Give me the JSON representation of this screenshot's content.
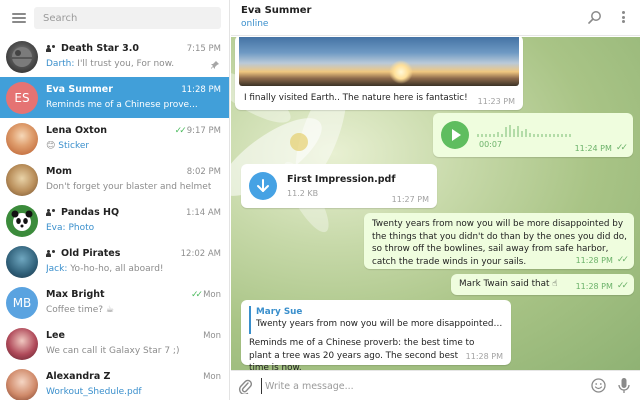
{
  "search": {
    "placeholder": "Search"
  },
  "chats": [
    {
      "name": "Death Star 3.0",
      "time": "7:15 PM",
      "sender": "Darth:",
      "message": "I'll trust you, For now.",
      "group": true,
      "pinned": true,
      "avatar_color": "#4a4a4a"
    },
    {
      "name": "Eva Summer",
      "time": "11:28 PM",
      "message": "Reminds me of a Chinese prove...",
      "initials": "ES",
      "avatar_color": "#e57373",
      "active": true
    },
    {
      "name": "Lena Oxton",
      "time": "9:17 PM",
      "icon_text": "😊",
      "message_link": "Sticker",
      "read": true,
      "avatar_color": "#f0a040"
    },
    {
      "name": "Mom",
      "time": "8:02 PM",
      "message": "Don't forget your blaster and helmet",
      "avatar_color": "#c9a66b"
    },
    {
      "name": "Pandas HQ",
      "time": "1:14 AM",
      "sender": "Eva:",
      "message_link": "Photo",
      "group": true,
      "avatar_color": "#2e7d32"
    },
    {
      "name": "Old Pirates",
      "time": "12:02 AM",
      "sender": "Jack:",
      "message": "Yo-ho-ho, all aboard!",
      "group": true,
      "avatar_color": "#3d6f8a"
    },
    {
      "name": "Max Bright",
      "time": "Mon",
      "message": "Coffee time? ☕",
      "initials": "MB",
      "avatar_color": "#5aa3e0",
      "read": true
    },
    {
      "name": "Lee",
      "time": "Mon",
      "message": "We can call it Galaxy Star 7 ;)",
      "avatar_color": "#b04a5a"
    },
    {
      "name": "Alexandra Z",
      "time": "Mon",
      "message_link": "Workout_Shedule.pdf",
      "avatar_color": "#d08a6a"
    }
  ],
  "header": {
    "name": "Eva Summer",
    "status": "online"
  },
  "messages": {
    "photo_caption": "I finally visited Earth.. The nature here is fantastic!",
    "photo_time": "11:23 PM",
    "voice_duration": "00:07",
    "voice_time": "11:24 PM",
    "file_name": "First Impression.pdf",
    "file_size": "11.2 KB",
    "file_time": "11:27 PM",
    "quote_text": "Twenty years from now you will be more disappointed by the things that you didn't do than by the ones you did do, so throw off the bowlines, sail away from safe harbor, catch the trade winds in your sails.",
    "quote_time": "11:28 PM",
    "author_text": "Mark Twain said that ☝",
    "author_time": "11:28 PM",
    "reply_name": "Mary Sue",
    "reply_preview": "Twenty years from now you will be more disappointed by t...",
    "reply_text": "Reminds me of a Chinese proverb: the best time to plant a tree was 20 years ago. The second best time is now.",
    "reply_time": "11:28 PM"
  },
  "composer": {
    "placeholder": "Write a message..."
  },
  "colors": {
    "accent": "#419fd9",
    "online": "#3a8fcc",
    "outgoing_bubble": "#effdde",
    "read_ticks": "#4dbb5f"
  }
}
